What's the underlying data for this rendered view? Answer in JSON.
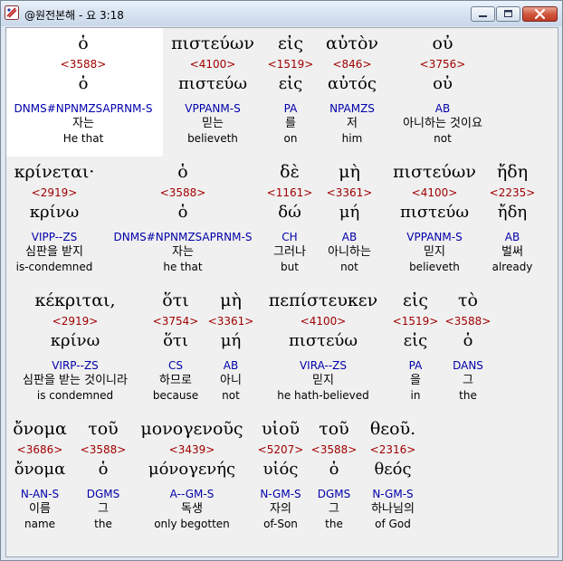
{
  "window": {
    "title": "@원전본해 - 요 3:18"
  },
  "rows": [
    {
      "words": [
        {
          "greek": "ὁ",
          "strong": "<3588>",
          "lemma": "ὁ",
          "morph": "DNMS#NPNMZSAPRNM-S",
          "korean": "자는",
          "english": "He that"
        },
        {
          "greek": "πιστεύων",
          "strong": "<4100>",
          "lemma": "πιστεύω",
          "morph": "VPPANM-S",
          "korean": "믿는",
          "english": "believeth"
        },
        {
          "greek": "εἰς",
          "strong": "<1519>",
          "lemma": "εἰς",
          "morph": "PA",
          "korean": "를",
          "english": "on"
        },
        {
          "greek": "αὐτὸν",
          "strong": "<846>",
          "lemma": "αὐτός",
          "morph": "NPAMZS",
          "korean": "저",
          "english": "him"
        },
        {
          "greek": "οὐ",
          "strong": "<3756>",
          "lemma": "οὐ",
          "morph": "AB",
          "korean": "아니하는 것이요",
          "english": "not"
        }
      ]
    },
    {
      "words": [
        {
          "greek": "κρίνεται·",
          "strong": "<2919>",
          "lemma": "κρίνω",
          "morph": "VIPP--ZS",
          "korean": "심판을 받지",
          "english": "is-condemned"
        },
        {
          "greek": "ὁ",
          "strong": "<3588>",
          "lemma": "ὁ",
          "morph": "DNMS#NPNMZSAPRNM-S",
          "korean": "자는",
          "english": "he that"
        },
        {
          "greek": "δὲ",
          "strong": "<1161>",
          "lemma": "δώ",
          "morph": "CH",
          "korean": "그러나",
          "english": "but"
        },
        {
          "greek": "μὴ",
          "strong": "<3361>",
          "lemma": "μή",
          "morph": "AB",
          "korean": "아니하는",
          "english": "not"
        },
        {
          "greek": "πιστεύων",
          "strong": "<4100>",
          "lemma": "πιστεύω",
          "morph": "VPPANM-S",
          "korean": "믿지",
          "english": "believeth"
        },
        {
          "greek": "ἤδη",
          "strong": "<2235>",
          "lemma": "ἤδη",
          "morph": "AB",
          "korean": "벌써",
          "english": "already"
        }
      ]
    },
    {
      "words": [
        {
          "greek": "κέκριται,",
          "strong": "<2919>",
          "lemma": "κρίνω",
          "morph": "VIRP--ZS",
          "korean": "심판을 받는 것이니라",
          "english": "is condemned"
        },
        {
          "greek": "ὅτι",
          "strong": "<3754>",
          "lemma": "ὅτι",
          "morph": "CS",
          "korean": "하므로",
          "english": "because"
        },
        {
          "greek": "μὴ",
          "strong": "<3361>",
          "lemma": "μή",
          "morph": "AB",
          "korean": "아니",
          "english": "not"
        },
        {
          "greek": "πεπίστευκεν",
          "strong": "<4100>",
          "lemma": "πιστεύω",
          "morph": "VIRA--ZS",
          "korean": "믿지",
          "english": "he hath-believed"
        },
        {
          "greek": "εἰς",
          "strong": "<1519>",
          "lemma": "εἰς",
          "morph": "PA",
          "korean": "을",
          "english": "in"
        },
        {
          "greek": "τὸ",
          "strong": "<3588>",
          "lemma": "ὁ",
          "morph": "DANS",
          "korean": "그",
          "english": "the"
        }
      ]
    },
    {
      "words": [
        {
          "greek": "ὄνομα",
          "strong": "<3686>",
          "lemma": "ὄνομα",
          "morph": "N-AN-S",
          "korean": "이름",
          "english": "name"
        },
        {
          "greek": "τοῦ",
          "strong": "<3588>",
          "lemma": "ὁ",
          "morph": "DGMS",
          "korean": "그",
          "english": "the"
        },
        {
          "greek": "μονογενοῦς",
          "strong": "<3439>",
          "lemma": "μόνογενής",
          "morph": "A--GM-S",
          "korean": "독생",
          "english": "only begotten"
        },
        {
          "greek": "υἱοῦ",
          "strong": "<5207>",
          "lemma": "υἱός",
          "morph": "N-GM-S",
          "korean": "자의",
          "english": "of-Son"
        },
        {
          "greek": "τοῦ",
          "strong": "<3588>",
          "lemma": "ὁ",
          "morph": "DGMS",
          "korean": "그",
          "english": "the"
        },
        {
          "greek": "θεοῦ.",
          "strong": "<2316>",
          "lemma": "θεός",
          "morph": "N-GM-S",
          "korean": "하나님의",
          "english": "of God"
        }
      ]
    }
  ]
}
